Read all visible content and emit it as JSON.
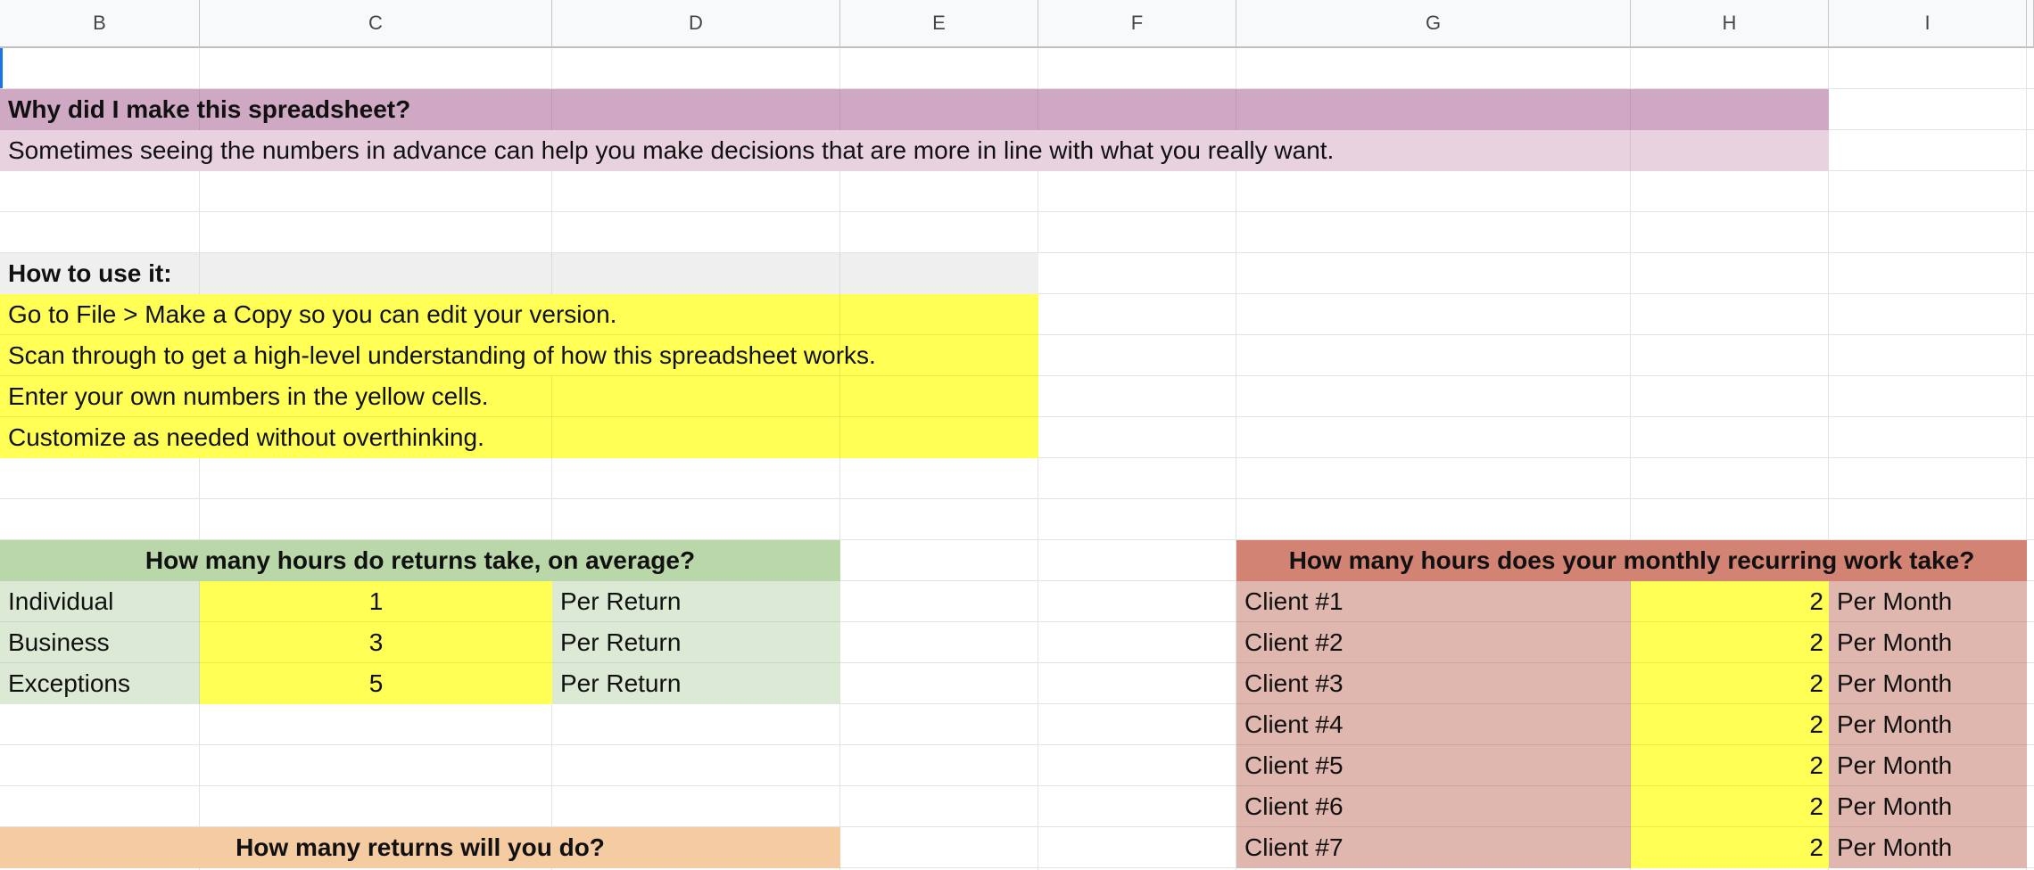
{
  "columns": [
    "B",
    "C",
    "D",
    "E",
    "F",
    "G",
    "H",
    "I"
  ],
  "colors": {
    "purple_header": "#cfa8c4",
    "purple_row": "#e8d2df",
    "gray_header": "#efefef",
    "yellow": "#ffff55",
    "green_header": "#b9d7a8",
    "green_row": "#dbe9d5",
    "red_header": "#d38373",
    "red_row": "#e0b7ae",
    "orange_header": "#f5cba2"
  },
  "why": {
    "title": "Why did I make this spreadsheet?",
    "body": "Sometimes seeing the numbers in advance can help you make decisions that are more in line with what you really want."
  },
  "howto": {
    "title": "How to use it:",
    "steps": [
      "Go to File > Make a Copy so you can edit your version.",
      "Scan through to get a high-level understanding of how this spreadsheet works.",
      "Enter your own numbers in the yellow cells.",
      "Customize as needed without overthinking."
    ]
  },
  "returns_hours": {
    "title": "How many hours do returns take, on average?",
    "rows": [
      {
        "label": "Individual",
        "value": "1",
        "unit": "Per Return"
      },
      {
        "label": "Business",
        "value": "3",
        "unit": "Per Return"
      },
      {
        "label": "Exceptions",
        "value": "5",
        "unit": "Per Return"
      }
    ]
  },
  "monthly": {
    "title": "How many hours does your monthly recurring work take?",
    "rows": [
      {
        "label": "Client #1",
        "value": "2",
        "unit": "Per Month"
      },
      {
        "label": "Client #2",
        "value": "2",
        "unit": "Per Month"
      },
      {
        "label": "Client #3",
        "value": "2",
        "unit": "Per Month"
      },
      {
        "label": "Client #4",
        "value": "2",
        "unit": "Per Month"
      },
      {
        "label": "Client #5",
        "value": "2",
        "unit": "Per Month"
      },
      {
        "label": "Client #6",
        "value": "2",
        "unit": "Per Month"
      },
      {
        "label": "Client #7",
        "value": "2",
        "unit": "Per Month"
      }
    ]
  },
  "returns_count": {
    "title": "How many returns will you do?"
  }
}
